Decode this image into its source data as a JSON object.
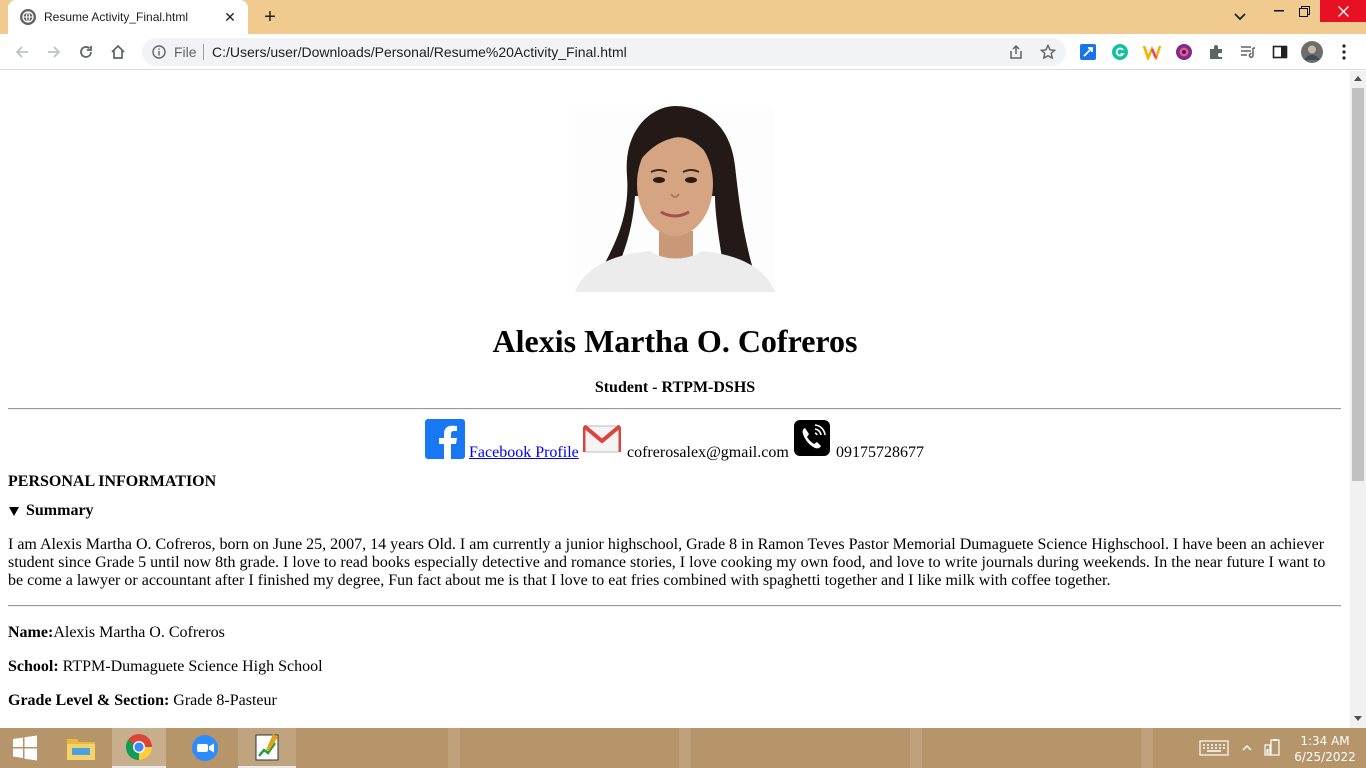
{
  "browser": {
    "tab_title": "Resume Activity_Final.html",
    "url_scheme": "File",
    "url": "C:/Users/user/Downloads/Personal/Resume%20Activity_Final.html"
  },
  "page": {
    "name": "Alexis Martha O. Cofreros",
    "subtitle": "Student - RTPM-DSHS",
    "contacts": {
      "facebook_label": "Facebook Profile",
      "email": "cofrerosalex@gmail.com",
      "phone": "09175728677"
    },
    "section_heading": "PERSONAL INFORMATION",
    "summary_label": "Summary",
    "summary_text": "I am Alexis Martha O. Cofreros, born on June 25, 2007, 14 years Old. I am currently a junior highschool, Grade 8 in Ramon Teves Pastor Memorial Dumaguete Science Highschool. I have been an achiever student since Grade 5 until now 8th grade. I love to read books especially detective and romance stories, I love cooking my own food, and love to write journals during weekends. In the near future I want to be come a lawyer or accountant after I finished my degree, Fun fact about me is that I love to eat fries combined with spaghetti together and I like milk with coffee together.",
    "fields": [
      {
        "label": "Name:",
        "value": "Alexis Martha O. Cofreros"
      },
      {
        "label": "School:",
        "value": " RTPM-Dumaguete Science High School"
      },
      {
        "label": "Grade Level & Section:",
        "value": " Grade 8-Pasteur"
      }
    ]
  },
  "taskbar": {
    "time": "1:34 AM",
    "date": "6/25/2022"
  }
}
